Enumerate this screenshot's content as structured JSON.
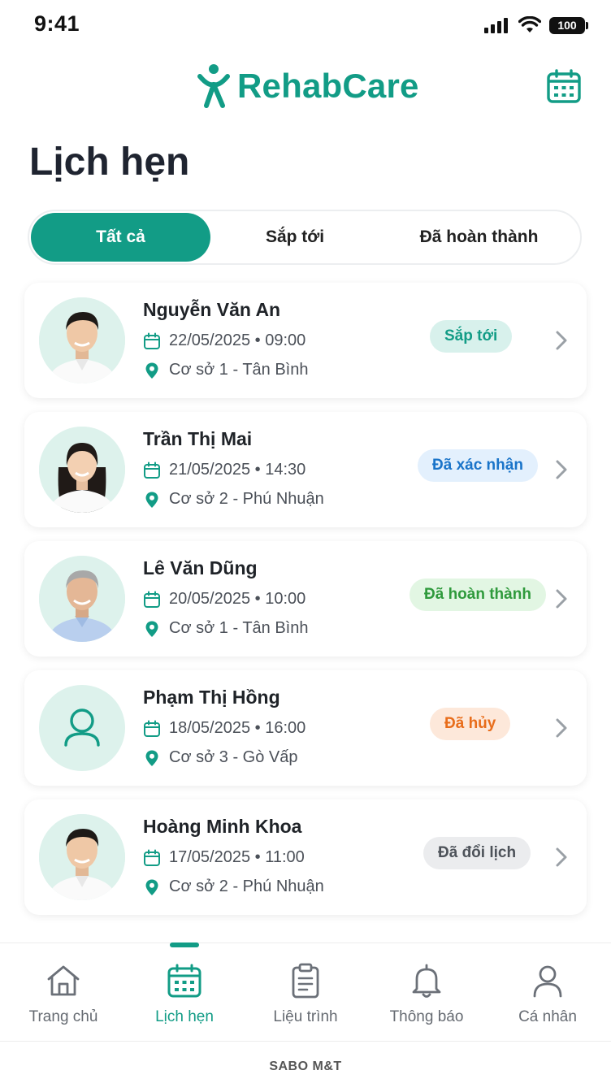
{
  "status_bar": {
    "time": "9:41",
    "battery": "100"
  },
  "header": {
    "brand_name": "RehabCare"
  },
  "page_title": "Lịch hẹn",
  "tabs": [
    {
      "label": "Tất cả",
      "active": true
    },
    {
      "label": "Sắp tới",
      "active": false
    },
    {
      "label": "Đã hoàn thành",
      "active": false
    }
  ],
  "appointments": [
    {
      "name": "Nguyễn Văn An",
      "datetime": "22/05/2025 • 09:00",
      "location": "Cơ sở 1 - Tân Bình",
      "status": "Sắp tới",
      "status_color": "#129c86",
      "avatar": "male-young"
    },
    {
      "name": "Trần Thị Mai",
      "datetime": "21/05/2025 • 14:30",
      "location": "Cơ sở 2 - Phú Nhuận",
      "status": "Đã xác nhận",
      "status_color": "#1a74c9",
      "avatar": "female-young"
    },
    {
      "name": "Lê Văn Dũng",
      "datetime": "20/05/2025 • 10:00",
      "location": "Cơ sở 1 - Tân Bình",
      "status": "Đã hoàn thành",
      "status_color": "#2f9a3c",
      "avatar": "male-senior"
    },
    {
      "name": "Phạm Thị Hồng",
      "datetime": "18/05/2025 • 16:00",
      "location": "Cơ sở 3 - Gò Vấp",
      "status": "Đã hủy",
      "status_color": "#e86d1b",
      "avatar": "user-icon"
    },
    {
      "name": "Hoàng Minh Khoa",
      "datetime": "17/05/2025 • 11:00",
      "location": "Cơ sở 2 - Phú Nhuận",
      "status": "Đã đổi lịch",
      "status_color": "#4d5259",
      "avatar": "male-young"
    }
  ],
  "bottom_nav": [
    {
      "label": "Trang chủ",
      "icon": "home-icon",
      "active": false
    },
    {
      "label": "Lịch hẹn",
      "icon": "calendar-icon",
      "active": true
    },
    {
      "label": "Liệu trình",
      "icon": "clipboard-icon",
      "active": false
    },
    {
      "label": "Thông báo",
      "icon": "bell-icon",
      "active": false
    },
    {
      "label": "Cá nhân",
      "icon": "user-icon",
      "active": false
    }
  ],
  "footer": "SABO M&T",
  "colors": {
    "brand": "#129c86",
    "text": "#1f2328",
    "muted": "#666b72"
  }
}
